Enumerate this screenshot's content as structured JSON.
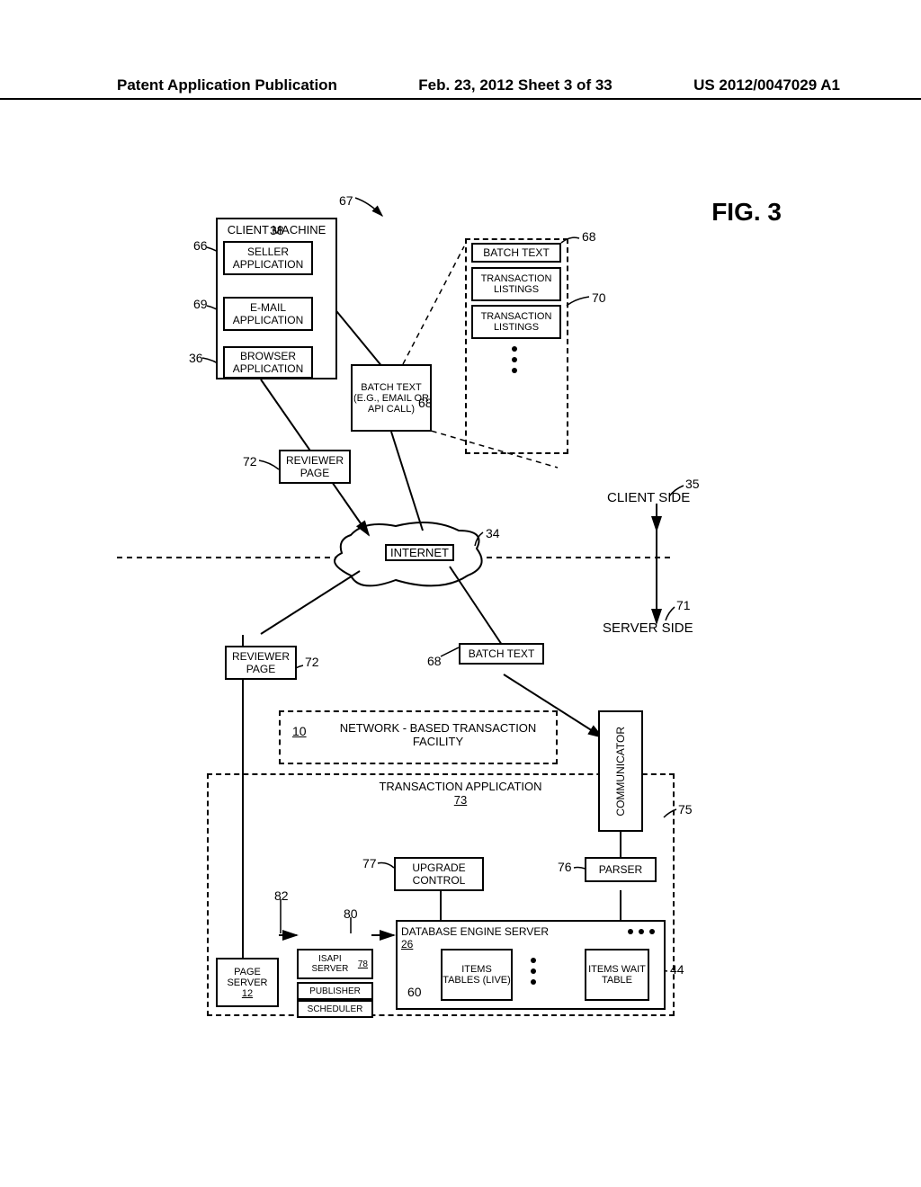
{
  "header": {
    "left": "Patent Application Publication",
    "center": "Feb. 23, 2012  Sheet 3 of 33",
    "right": "US 2012/0047029 A1"
  },
  "figure_title": "FIG. 3",
  "labels": {
    "client_machine": "CLIENT MACHINE",
    "seller_application": "SELLER APPLICATION",
    "email_application": "E-MAIL APPLICATION",
    "browser_application": "BROWSER APPLICATION",
    "batch_text_top": "BATCH TEXT",
    "transaction_listings": "TRANSACTION LISTINGS",
    "batch_text_email": "BATCH TEXT (E.G., EMAIL OR API CALL)",
    "reviewer_page": "REVIEWER PAGE",
    "client_side": "CLIENT SIDE",
    "internet": "INTERNET",
    "server_side": "SERVER SIDE",
    "reviewer_page2": "REVIEWER PAGE",
    "batch_text2": "BATCH TEXT",
    "nbt_facility": "NETWORK - BASED TRANSACTION FACILITY",
    "transaction_app": "TRANSACTION APPLICATION",
    "upgrade_control": "UPGRADE CONTROL",
    "communicator": "COMMUNICATOR",
    "parser": "PARSER",
    "database_engine": "DATABASE ENGINE SERVER",
    "page_server": "PAGE SERVER",
    "isapi_server": "ISAPI SERVER",
    "publisher": "PUBLISHER",
    "scheduler": "SCHEDULER",
    "items_tables_live": "ITEMS TABLES (LIVE)",
    "items_wait_table": "ITEMS WAIT TABLE"
  },
  "refs": {
    "r67": "67",
    "r66": "66",
    "r38": "38",
    "r69": "69",
    "r36": "36",
    "r68a": "68",
    "r68b": "68",
    "r68c": "68",
    "r70": "70",
    "r72a": "72",
    "r72b": "72",
    "r35": "35",
    "r34": "34",
    "r71": "71",
    "r10": "10",
    "r73": "73",
    "r75": "75",
    "r76": "76",
    "r77": "77",
    "r78": "78",
    "r80": "80",
    "r82": "82",
    "r12": "12",
    "r26": "26",
    "r60": "60",
    "r44": "44"
  }
}
